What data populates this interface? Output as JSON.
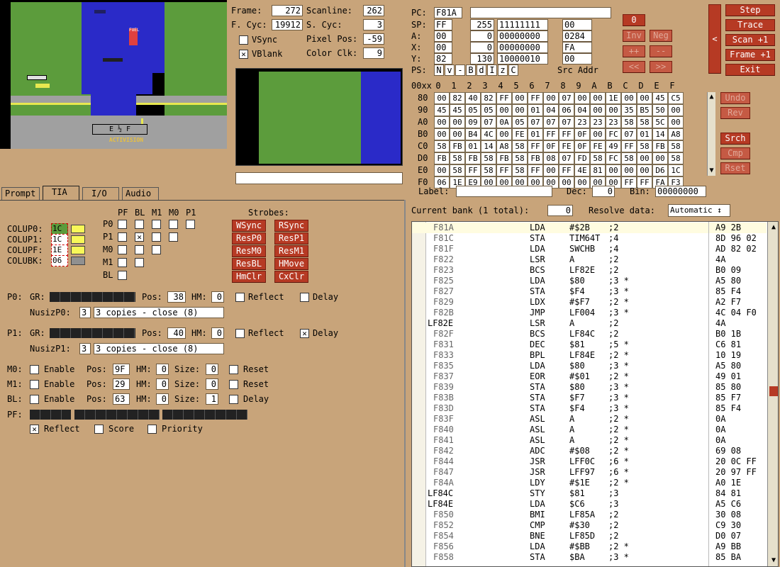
{
  "frame": {
    "label": "Frame:",
    "value": "272"
  },
  "scanline": {
    "label": "Scanline:",
    "value": "262"
  },
  "fcyc": {
    "label": "F. Cyc:",
    "value": "19912"
  },
  "scyc": {
    "label": "S. Cyc:",
    "value": "3"
  },
  "vsync": {
    "label": "VSync",
    "checked": false
  },
  "vblank": {
    "label": "VBlank",
    "checked": true
  },
  "pixelpos": {
    "label": "Pixel Pos:",
    "value": "-59"
  },
  "colorclk": {
    "label": "Color Clk:",
    "value": "9"
  },
  "cpu": {
    "pc": {
      "label": "PC:",
      "value": "F81A",
      "extra": ""
    },
    "sp": {
      "label": "SP:",
      "hex": "FF",
      "dec": "255",
      "bin": "11111111",
      "src": "00"
    },
    "a": {
      "label": "A:",
      "hex": "00",
      "dec": "0",
      "bin": "00000000",
      "src": "0284"
    },
    "x": {
      "label": "X:",
      "hex": "00",
      "dec": "0",
      "bin": "00000000",
      "src": "FA"
    },
    "y": {
      "label": "Y:",
      "hex": "82",
      "dec": "130",
      "bin": "10000010",
      "src": "00"
    },
    "ps_label": "PS:",
    "flags": [
      "N",
      "v",
      "-",
      "B",
      "d",
      "I",
      "z",
      "C"
    ],
    "src_addr": "Src Addr"
  },
  "cpu_buttons": {
    "zero": "0",
    "inv": "Inv",
    "neg": "Neg",
    "inc": "++",
    "dec": "--",
    "shl": "<<",
    "shr": ">>",
    "side": "<"
  },
  "main_buttons": {
    "step": "Step",
    "trace": "Trace",
    "scan": "Scan +1",
    "frame": "Frame +1",
    "exit": "Exit"
  },
  "ram": {
    "corner": "00xx",
    "cols": [
      "0",
      "1",
      "2",
      "3",
      "4",
      "5",
      "6",
      "7",
      "8",
      "9",
      "A",
      "B",
      "C",
      "D",
      "E",
      "F"
    ],
    "rows": [
      {
        "addr": "80",
        "cells": [
          "00",
          "82",
          "40",
          "82",
          "FF",
          "00",
          "FF",
          "00",
          "07",
          "00",
          "00",
          "1E",
          "00",
          "00",
          "45",
          "C5"
        ]
      },
      {
        "addr": "90",
        "cells": [
          "45",
          "45",
          "05",
          "05",
          "00",
          "00",
          "01",
          "04",
          "06",
          "04",
          "00",
          "00",
          "35",
          "B5",
          "50",
          "00"
        ]
      },
      {
        "addr": "A0",
        "cells": [
          "00",
          "00",
          "09",
          "07",
          "0A",
          "05",
          "07",
          "07",
          "07",
          "23",
          "23",
          "23",
          "58",
          "58",
          "5C",
          "00"
        ]
      },
      {
        "addr": "B0",
        "cells": [
          "00",
          "00",
          "B4",
          "4C",
          "00",
          "FE",
          "01",
          "FF",
          "FF",
          "0F",
          "00",
          "FC",
          "07",
          "01",
          "14",
          "A8"
        ]
      },
      {
        "addr": "C0",
        "cells": [
          "58",
          "FB",
          "01",
          "14",
          "A8",
          "58",
          "FF",
          "0F",
          "FE",
          "0F",
          "FE",
          "49",
          "FF",
          "58",
          "FB",
          "58"
        ]
      },
      {
        "addr": "D0",
        "cells": [
          "FB",
          "58",
          "FB",
          "58",
          "FB",
          "58",
          "FB",
          "08",
          "07",
          "FD",
          "58",
          "FC",
          "58",
          "00",
          "00",
          "58"
        ]
      },
      {
        "addr": "E0",
        "cells": [
          "00",
          "58",
          "FF",
          "58",
          "FF",
          "58",
          "FF",
          "00",
          "FF",
          "4E",
          "81",
          "00",
          "00",
          "00",
          "D6",
          "1C"
        ]
      },
      {
        "addr": "F0",
        "cells": [
          "06",
          "1E",
          "E9",
          "00",
          "00",
          "00",
          "00",
          "00",
          "00",
          "00",
          "00",
          "00",
          "FF",
          "FF",
          "FA",
          "F3"
        ]
      }
    ],
    "buttons": {
      "undo": "Undo",
      "rev": "Rev",
      "srch": "Srch",
      "cmp": "Cmp",
      "rset": "Rset"
    }
  },
  "label_row": {
    "label": "Label:",
    "label_value": "",
    "dec": "Dec:",
    "dec_value": "0",
    "bin": "Bin:",
    "bin_value": "00000000"
  },
  "bank": {
    "label": "Current bank (1 total):",
    "value": "0",
    "resolve": "Resolve data:",
    "resolve_value": "Automatic ↕"
  },
  "tabs": [
    "Prompt",
    "TIA",
    "I/O",
    "Audio"
  ],
  "tia": {
    "colors": [
      {
        "label": "COLUP0:",
        "value": "1C",
        "color": "#f8f858"
      },
      {
        "label": "COLUP1:",
        "value": "1C",
        "color": "#f8f858"
      },
      {
        "label": "COLUPF:",
        "value": "1E",
        "color": "#f8f858"
      },
      {
        "label": "COLUBK:",
        "value": "06",
        "color": "#909090"
      }
    ],
    "coll_cols": [
      "PF",
      "BL",
      "M1",
      "M0",
      "P1"
    ],
    "coll_rows": [
      "P0",
      "P1",
      "M0",
      "M1",
      "BL"
    ],
    "strobes_title": "Strobes:",
    "strobes": [
      "WSync",
      "RSync",
      "ResP0",
      "ResP1",
      "ResM0",
      "ResM1",
      "ResBL",
      "HMove",
      "HmClr",
      "CxClr"
    ],
    "p0": {
      "label": "P0:",
      "gr": "GR:",
      "pos": "Pos:",
      "pos_v": "38",
      "hm": "HM:",
      "hm_v": "0",
      "reflect": "Reflect",
      "delay": "Delay",
      "nusiz_label": "NusizP0:",
      "nusiz_v": "3",
      "nusiz_desc": "3 copies - close (8)"
    },
    "p1": {
      "label": "P1:",
      "gr": "GR:",
      "pos": "Pos:",
      "pos_v": "40",
      "hm": "HM:",
      "hm_v": "0",
      "reflect": "Reflect",
      "delay": "Delay",
      "nusiz_label": "NusizP1:",
      "nusiz_v": "3",
      "nusiz_desc": "3 copies - close (8)"
    },
    "m0": {
      "label": "M0:",
      "enable": "Enable",
      "pos": "Pos:",
      "pos_v": "9F",
      "hm": "HM:",
      "hm_v": "0",
      "size": "Size:",
      "size_v": "0",
      "reset": "Reset"
    },
    "m1": {
      "label": "M1:",
      "enable": "Enable",
      "pos": "Pos:",
      "pos_v": "29",
      "hm": "HM:",
      "hm_v": "0",
      "size": "Size:",
      "size_v": "0",
      "reset": "Reset"
    },
    "bl": {
      "label": "BL:",
      "enable": "Enable",
      "pos": "Pos:",
      "pos_v": "63",
      "hm": "HM:",
      "hm_v": "0",
      "size": "Size:",
      "size_v": "1",
      "delay": "Delay"
    },
    "pf": {
      "label": "PF:",
      "reflect": "Reflect",
      "score": "Score",
      "priority": "Priority"
    }
  },
  "disasm": [
    {
      "lbl": "",
      "addr": "F81A",
      "op": "LDA",
      "arg": "#$2B",
      "cyc": ";2",
      "bytes": "A9 2B"
    },
    {
      "lbl": "",
      "addr": "F81C",
      "op": "STA",
      "arg": "TIM64T",
      "cyc": ";4",
      "bytes": "8D 96 02"
    },
    {
      "lbl": "",
      "addr": "F81F",
      "op": "LDA",
      "arg": "SWCHB",
      "cyc": ";4",
      "bytes": "AD 82 02"
    },
    {
      "lbl": "",
      "addr": "F822",
      "op": "LSR",
      "arg": "A",
      "cyc": ";2",
      "bytes": "4A"
    },
    {
      "lbl": "",
      "addr": "F823",
      "op": "BCS",
      "arg": "LF82E",
      "cyc": ";2",
      "bytes": "B0 09"
    },
    {
      "lbl": "",
      "addr": "F825",
      "op": "LDA",
      "arg": "$80",
      "cyc": ";3 *",
      "bytes": "A5 80"
    },
    {
      "lbl": "",
      "addr": "F827",
      "op": "STA",
      "arg": "$F4",
      "cyc": ";3 *",
      "bytes": "85 F4"
    },
    {
      "lbl": "",
      "addr": "F829",
      "op": "LDX",
      "arg": "#$F7",
      "cyc": ";2 *",
      "bytes": "A2 F7"
    },
    {
      "lbl": "",
      "addr": "F82B",
      "op": "JMP",
      "arg": "LF004",
      "cyc": ";3 *",
      "bytes": "4C 04 F0"
    },
    {
      "lbl": "LF82E",
      "addr": "",
      "op": "LSR",
      "arg": "A",
      "cyc": ";2",
      "bytes": "4A"
    },
    {
      "lbl": "",
      "addr": "F82F",
      "op": "BCS",
      "arg": "LF84C",
      "cyc": ";2",
      "bytes": "B0 1B"
    },
    {
      "lbl": "",
      "addr": "F831",
      "op": "DEC",
      "arg": "$81",
      "cyc": ";5 *",
      "bytes": "C6 81"
    },
    {
      "lbl": "",
      "addr": "F833",
      "op": "BPL",
      "arg": "LF84E",
      "cyc": ";2 *",
      "bytes": "10 19"
    },
    {
      "lbl": "",
      "addr": "F835",
      "op": "LDA",
      "arg": "$80",
      "cyc": ";3 *",
      "bytes": "A5 80"
    },
    {
      "lbl": "",
      "addr": "F837",
      "op": "EOR",
      "arg": "#$01",
      "cyc": ";2 *",
      "bytes": "49 01"
    },
    {
      "lbl": "",
      "addr": "F839",
      "op": "STA",
      "arg": "$80",
      "cyc": ";3 *",
      "bytes": "85 80"
    },
    {
      "lbl": "",
      "addr": "F83B",
      "op": "STA",
      "arg": "$F7",
      "cyc": ";3 *",
      "bytes": "85 F7"
    },
    {
      "lbl": "",
      "addr": "F83D",
      "op": "STA",
      "arg": "$F4",
      "cyc": ";3 *",
      "bytes": "85 F4"
    },
    {
      "lbl": "",
      "addr": "F83F",
      "op": "ASL",
      "arg": "A",
      "cyc": ";2 *",
      "bytes": "0A"
    },
    {
      "lbl": "",
      "addr": "F840",
      "op": "ASL",
      "arg": "A",
      "cyc": ";2 *",
      "bytes": "0A"
    },
    {
      "lbl": "",
      "addr": "F841",
      "op": "ASL",
      "arg": "A",
      "cyc": ";2 *",
      "bytes": "0A"
    },
    {
      "lbl": "",
      "addr": "F842",
      "op": "ADC",
      "arg": "#$08",
      "cyc": ";2 *",
      "bytes": "69 08"
    },
    {
      "lbl": "",
      "addr": "F844",
      "op": "JSR",
      "arg": "LFF0C",
      "cyc": ";6 *",
      "bytes": "20 0C FF"
    },
    {
      "lbl": "",
      "addr": "F847",
      "op": "JSR",
      "arg": "LFF97",
      "cyc": ";6 *",
      "bytes": "20 97 FF"
    },
    {
      "lbl": "",
      "addr": "F84A",
      "op": "LDY",
      "arg": "#$1E",
      "cyc": ";2 *",
      "bytes": "A0 1E"
    },
    {
      "lbl": "LF84C",
      "addr": "",
      "op": "STY",
      "arg": "$81",
      "cyc": ";3",
      "bytes": "84 81"
    },
    {
      "lbl": "LF84E",
      "addr": "",
      "op": "LDA",
      "arg": "$C6",
      "cyc": ";3",
      "bytes": "A5 C6"
    },
    {
      "lbl": "",
      "addr": "F850",
      "op": "BMI",
      "arg": "LF85A",
      "cyc": ";2",
      "bytes": "30 08"
    },
    {
      "lbl": "",
      "addr": "F852",
      "op": "CMP",
      "arg": "#$30",
      "cyc": ";2",
      "bytes": "C9 30"
    },
    {
      "lbl": "",
      "addr": "F854",
      "op": "BNE",
      "arg": "LF85D",
      "cyc": ";2",
      "bytes": "D0 07"
    },
    {
      "lbl": "",
      "addr": "F856",
      "op": "LDA",
      "arg": "#$BB",
      "cyc": ";2 *",
      "bytes": "A9 BB"
    },
    {
      "lbl": "",
      "addr": "F858",
      "op": "STA",
      "arg": "$BA",
      "cyc": ";3 *",
      "bytes": "85 BA"
    }
  ],
  "game": {
    "fuel": "FUEL",
    "gauge": "E  ½  F",
    "brand": "ACTIVISION"
  },
  "colors": {
    "river": "#2a2ac8",
    "land": "#5c9c3c",
    "road": "#a0a0a0",
    "panel": "#c8a47a",
    "btn": "#b63a24"
  }
}
